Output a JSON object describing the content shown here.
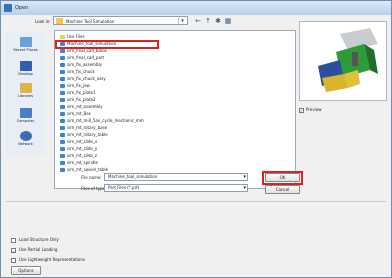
{
  "window": {
    "title": "Open"
  },
  "lookin": {
    "label": "Look in:",
    "value": "Machine Tool Simulation"
  },
  "places": [
    {
      "label": "Recent Places",
      "icon": "recent-places-icon"
    },
    {
      "label": "Desktop",
      "icon": "desktop-icon"
    },
    {
      "label": "Libraries",
      "icon": "libraries-icon"
    },
    {
      "label": "Computer",
      "icon": "computer-icon"
    },
    {
      "label": "Network",
      "icon": "network-icon"
    }
  ],
  "files": [
    {
      "name": "Use Files",
      "type": "folder"
    },
    {
      "name": "Machine_tool_simulation",
      "type": "assembly"
    },
    {
      "name": "sim_final_cad_blank",
      "type": "assembly"
    },
    {
      "name": "sim_final_cad_part",
      "type": "assembly"
    },
    {
      "name": "sim_fix_assembly",
      "type": "assembly"
    },
    {
      "name": "sim_fix_chuck",
      "type": "assembly"
    },
    {
      "name": "sim_fix_chuck_assy",
      "type": "assembly"
    },
    {
      "name": "sim_fix_jaw",
      "type": "assembly"
    },
    {
      "name": "sim_fix_plate1",
      "type": "assembly"
    },
    {
      "name": "sim_fix_plate2",
      "type": "assembly"
    },
    {
      "name": "sim_mt_assembly",
      "type": "assembly"
    },
    {
      "name": "sim_mt_Bas",
      "type": "assembly"
    },
    {
      "name": "sim_mt_mill_5ax_cycle_mechanic_mm",
      "type": "assembly"
    },
    {
      "name": "sim_mt_rotary_base",
      "type": "assembly"
    },
    {
      "name": "sim_mt_rotary_table",
      "type": "assembly"
    },
    {
      "name": "sim_mt_slide_x",
      "type": "assembly"
    },
    {
      "name": "sim_mt_slide_y",
      "type": "assembly"
    },
    {
      "name": "sim_mt_slide_z",
      "type": "assembly"
    },
    {
      "name": "sim_mt_spindle",
      "type": "assembly"
    },
    {
      "name": "sim_mt_swivel_table",
      "type": "assembly"
    }
  ],
  "filename": {
    "label": "File name:",
    "value": "Machine_tool_simulation"
  },
  "filetype": {
    "label": "Files of type:",
    "value": "Part Files (*.prt)"
  },
  "buttons": {
    "ok": "OK",
    "cancel": "Cancel",
    "options": "Options"
  },
  "preview": {
    "label": "Preview",
    "checked": true
  },
  "checks": [
    {
      "label": "Load Structure Only",
      "checked": false
    },
    {
      "label": "Use Partial Loading",
      "checked": true
    },
    {
      "label": "Use Lightweight Representations",
      "checked": false
    }
  ],
  "colors": {
    "highlight": "#e0201c",
    "titlebar": "#b9d0ea"
  }
}
